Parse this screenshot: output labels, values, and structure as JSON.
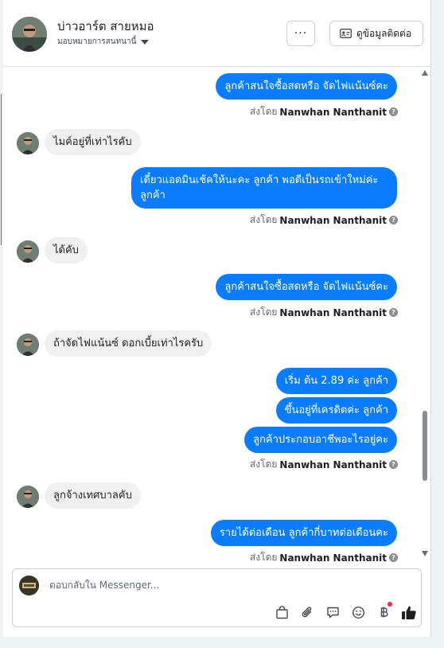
{
  "header": {
    "name": "บ่าวอาร์ต สายหมอ",
    "assign_label": "มอบหมายการสนทนานี้",
    "more_label": "···",
    "contact_label": "ดูข้อมูลติดต่อ"
  },
  "messages": [
    {
      "dir": "out",
      "text": "ลูกค้าสนใจซื้อสดหรือ จัดไฟแน้นซ์คะ"
    },
    {
      "dir": "in",
      "text": "ไมค์อยู่ที่เท่าไรคับ"
    },
    {
      "dir": "out",
      "text": "เดี๋ยวแอดมินเช้คให้นะคะ ลูกค้า พอดีเป็นรถเข้าใหม่ค่ะ ลูกค้า"
    },
    {
      "dir": "in",
      "text": "ได้คับ"
    },
    {
      "dir": "out",
      "text": "ลูกค้าสนใจซื้อสดหรือ จัดไฟแน้นซ์คะ"
    },
    {
      "dir": "in",
      "text": "ถ้าจัดไฟแน้นซ์ ดอกเบี้ยเท่าไรครับ"
    },
    {
      "dir": "out",
      "text": "เริ่ม ต้น 2.89 ค่ะ ลูกค้า"
    },
    {
      "dir": "out",
      "text": "ขึ้นอยู่ที่เครดิตค่ะ ลูกค้า"
    },
    {
      "dir": "out",
      "text": "ลูกค้าประกอบอาชีพอะไรอยู่คะ"
    },
    {
      "dir": "in",
      "text": "ลูกจ้างเทศบาลคับ"
    },
    {
      "dir": "out",
      "text": "รายได้ต่อเดือน ลูกค้ากี่บาทต่อเดือนคะ"
    }
  ],
  "sent_by": {
    "prefix": "ส่งโดย",
    "name": "Nanwhan Nanthanit"
  },
  "composer": {
    "placeholder": "ตอบกลับใน Messenger..."
  },
  "icons": {
    "more": "ellipsis-icon",
    "contact": "contact-card-icon",
    "help": "question-icon",
    "tools": [
      "shopping-bag-icon",
      "paperclip-icon",
      "saved-reply-icon",
      "emoji-icon",
      "baht-payment-icon",
      "like-thumb-icon"
    ]
  },
  "colors": {
    "outgoing": "#0a7cff",
    "incoming": "#f0f0f0",
    "badge": "#f02849"
  }
}
